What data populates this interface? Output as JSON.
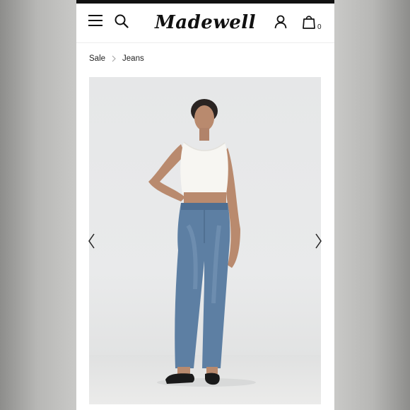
{
  "header": {
    "brand": "Madewell",
    "cart_count": "0",
    "icons": {
      "menu": "menu-icon",
      "search": "search-icon",
      "account": "account-icon",
      "cart": "shopping-bag-icon"
    }
  },
  "breadcrumb": {
    "items": [
      "Sale",
      "Jeans"
    ]
  },
  "product_image": {
    "alt": "Model wearing white cropped tank top and high-rise straight blue jeans with black flats",
    "prev": "chevron-left-icon",
    "next": "chevron-right-icon"
  },
  "colors": {
    "background": "#ffffff",
    "text": "#111111",
    "denim": "#5d7fa3",
    "photo_bg": "#e7e8e9"
  }
}
